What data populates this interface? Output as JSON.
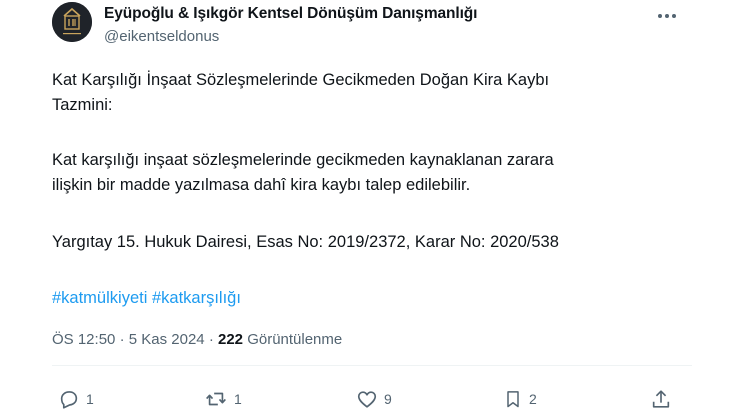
{
  "tweet": {
    "author_name": "Eyüpoğlu & Işıkgör Kentsel Dönüşüm Danışmanlığı",
    "handle": "@eikentseldonus",
    "paragraph1_line1": "Kat Karşılığı İnşaat Sözleşmelerinde Gecikmeden Doğan Kira Kaybı",
    "paragraph1_line2": "Tazmini:",
    "paragraph2_line1": "Kat karşılığı inşaat sözleşmelerinde gecikmeden kaynaklanan zarara",
    "paragraph2_line2": "ilişkin bir madde yazılmasa dahî kira kaybı talep edilebilir.",
    "paragraph3": "Yargıtay 15. Hukuk Dairesi, Esas No: 2019/2372, Karar No: 2020/538",
    "hashtags": [
      "#katmülkiyeti",
      "#katkarşılığı"
    ],
    "time": "ÖS 12:50",
    "date": "5 Kas 2024",
    "views_count": "222",
    "views_label": "Görüntülenme"
  },
  "actions": {
    "reply_count": "1",
    "retweet_count": "1",
    "like_count": "9",
    "bookmark_count": "2"
  },
  "icons": {
    "more": "more-horizontal-icon",
    "reply": "reply-icon",
    "retweet": "retweet-icon",
    "like": "heart-icon",
    "bookmark": "bookmark-icon",
    "share": "share-icon"
  },
  "colors": {
    "text": "#0f1419",
    "secondary": "#536471",
    "link": "#1d9bf0",
    "logo_gold": "#c9a45c"
  }
}
